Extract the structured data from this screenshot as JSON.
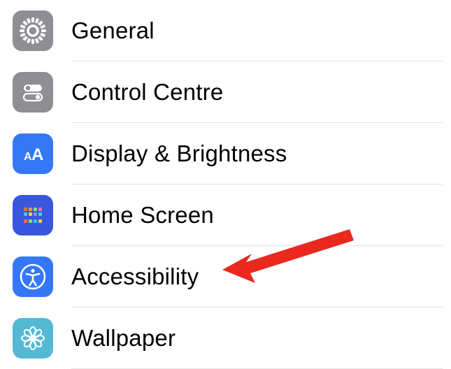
{
  "settings": {
    "items": [
      {
        "id": "general",
        "label": "General",
        "icon": "gear-icon",
        "color": "gray"
      },
      {
        "id": "control-centre",
        "label": "Control Centre",
        "icon": "toggles-icon",
        "color": "gray"
      },
      {
        "id": "display-brightness",
        "label": "Display & Brightness",
        "icon": "text-size-icon",
        "color": "blue"
      },
      {
        "id": "home-screen",
        "label": "Home Screen",
        "icon": "app-grid-icon",
        "color": "indigo"
      },
      {
        "id": "accessibility",
        "label": "Accessibility",
        "icon": "accessibility-icon",
        "color": "blue"
      },
      {
        "id": "wallpaper",
        "label": "Wallpaper",
        "icon": "flower-icon",
        "color": "teal"
      }
    ]
  },
  "annotation": {
    "target": "accessibility",
    "type": "red-arrow"
  }
}
